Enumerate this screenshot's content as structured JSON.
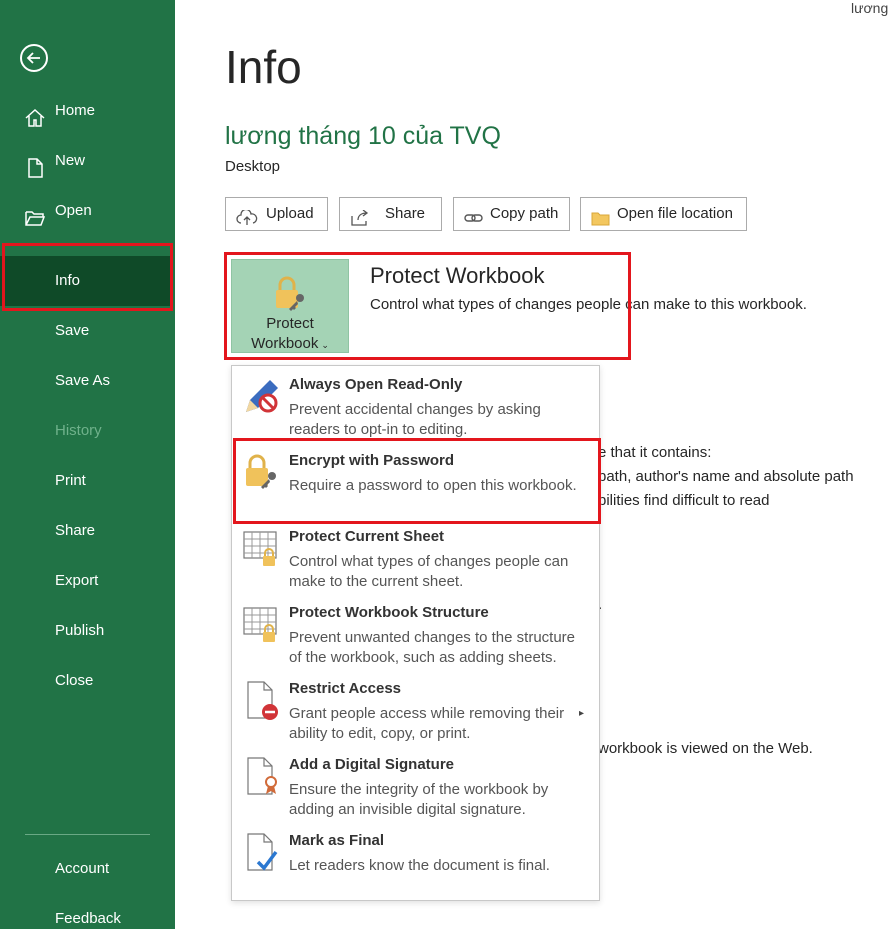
{
  "sidebar": {
    "items": [
      {
        "key": "home",
        "label": "Home"
      },
      {
        "key": "new",
        "label": "New"
      },
      {
        "key": "open",
        "label": "Open"
      },
      {
        "key": "info",
        "label": "Info"
      },
      {
        "key": "save",
        "label": "Save"
      },
      {
        "key": "save_as",
        "label": "Save As"
      },
      {
        "key": "history",
        "label": "History"
      },
      {
        "key": "print",
        "label": "Print"
      },
      {
        "key": "share",
        "label": "Share"
      },
      {
        "key": "export",
        "label": "Export"
      },
      {
        "key": "publish",
        "label": "Publish"
      },
      {
        "key": "close",
        "label": "Close"
      }
    ],
    "account": "Account",
    "feedback": "Feedback"
  },
  "top_right_text": "lương",
  "page_title": "Info",
  "file": {
    "title": "lương tháng 10 của TVQ",
    "location": "Desktop"
  },
  "buttons": {
    "upload": "Upload",
    "share": "Share",
    "copy_path": "Copy path",
    "open_location": "Open file location"
  },
  "protect": {
    "button_line1": "Protect",
    "button_line2": "Workbook",
    "heading": "Protect Workbook",
    "description": "Control what types of changes people can make to this workbook."
  },
  "background_text": {
    "line1": "e that it contains:",
    "line2": "path, author's name and absolute path",
    "line3": "bilities find difficult to read",
    "line4": ".",
    "line5": "workbook is viewed on the Web."
  },
  "menu": [
    {
      "title": "Always Open Read-Only",
      "desc": "Prevent accidental changes by asking readers to opt-in to editing.",
      "icon": "pencil-no-icon"
    },
    {
      "title": "Encrypt with Password",
      "desc": "Require a password to open this workbook.",
      "icon": "lock-key-icon"
    },
    {
      "title": "Protect Current Sheet",
      "desc": "Control what types of changes people can make to the current sheet.",
      "icon": "sheet-lock-icon"
    },
    {
      "title": "Protect Workbook Structure",
      "desc": "Prevent unwanted changes to the structure of the workbook, such as adding sheets.",
      "icon": "workbook-lock-icon"
    },
    {
      "title": "Restrict Access",
      "desc": "Grant people access while removing their ability to edit, copy, or print.",
      "icon": "document-restrict-icon"
    },
    {
      "title": "Add a Digital Signature",
      "desc": "Ensure the integrity of the workbook by adding an invisible digital signature.",
      "icon": "signature-ribbon-icon"
    },
    {
      "title": "Mark as Final",
      "desc": "Let readers know the document is final.",
      "icon": "document-check-icon"
    }
  ],
  "colors": {
    "brand": "#217346",
    "sidebar_selected": "#0f4a28",
    "highlight": "#e3161d",
    "protect_button": "#a4d3b5"
  }
}
